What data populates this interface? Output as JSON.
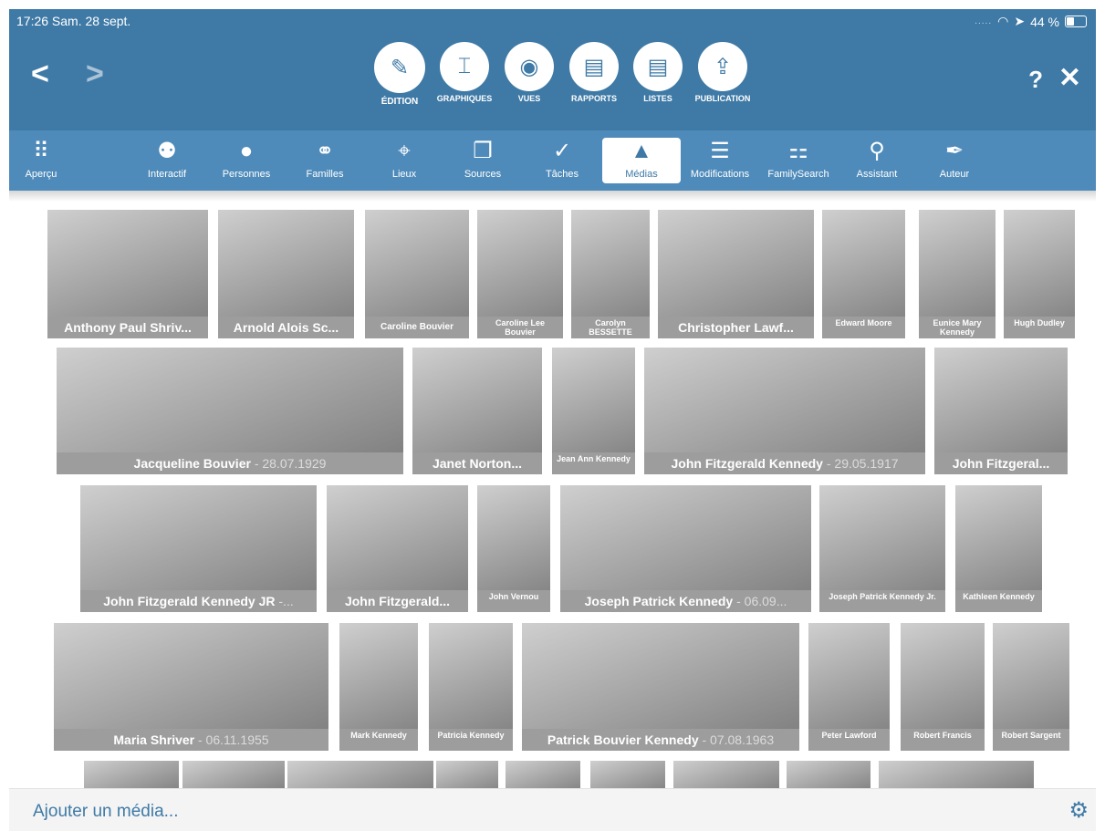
{
  "status": {
    "time": "17:26  Sam. 28 sept.",
    "signal": ".....",
    "wifi_icon": "wifi-icon",
    "location_icon": "location-icon",
    "battery": "44 %"
  },
  "toolbar": {
    "back": "<",
    "forward": ">",
    "help": "?",
    "close": "✕",
    "modes": [
      {
        "label": "ÉDITION",
        "icon": "pencil-icon",
        "glyph": "✎",
        "active": true
      },
      {
        "label": "GRAPHIQUES",
        "icon": "chart-icon",
        "glyph": "⌶"
      },
      {
        "label": "VUES",
        "icon": "eye-icon",
        "glyph": "◉"
      },
      {
        "label": "RAPPORTS",
        "icon": "report-icon",
        "glyph": "▤"
      },
      {
        "label": "LISTES",
        "icon": "list-icon",
        "glyph": "▤"
      },
      {
        "label": "PUBLICATION",
        "icon": "upload-icon",
        "glyph": "⇪"
      }
    ]
  },
  "subnav": [
    {
      "label": "Aperçu",
      "icon": "grid-icon",
      "glyph": "⠿"
    },
    {
      "label": "Interactif",
      "icon": "tree-icon",
      "glyph": "⚉"
    },
    {
      "label": "Personnes",
      "icon": "person-icon",
      "glyph": "●"
    },
    {
      "label": "Familles",
      "icon": "rings-icon",
      "glyph": "⚭"
    },
    {
      "label": "Lieux",
      "icon": "pin-icon",
      "glyph": "⌖"
    },
    {
      "label": "Sources",
      "icon": "sources-icon",
      "glyph": "❐"
    },
    {
      "label": "Tâches",
      "icon": "check-icon",
      "glyph": "✓"
    },
    {
      "label": "Médias",
      "icon": "media-icon",
      "glyph": "▲",
      "active": true
    },
    {
      "label": "Modifications",
      "icon": "changes-icon",
      "glyph": "☰"
    },
    {
      "label": "FamilySearch",
      "icon": "familysearch-icon",
      "glyph": "⚏"
    },
    {
      "label": "Assistant",
      "icon": "assistant-icon",
      "glyph": "⚲"
    },
    {
      "label": "Auteur",
      "icon": "pen-icon",
      "glyph": "✒"
    }
  ],
  "media": [
    {
      "name": "Anthony Paul Shriv...",
      "date": ""
    },
    {
      "name": "Arnold Alois Sc...",
      "date": ""
    },
    {
      "name": "Caroline Bouvier",
      "date": ""
    },
    {
      "name": "Caroline Lee Bouvier",
      "date": ""
    },
    {
      "name": "Carolyn BESSETTE",
      "date": ""
    },
    {
      "name": "Christopher Lawf...",
      "date": ""
    },
    {
      "name": "Edward Moore",
      "date": ""
    },
    {
      "name": "Eunice Mary Kennedy",
      "date": ""
    },
    {
      "name": "Hugh Dudley",
      "date": ""
    },
    {
      "name": "Jacqueline Bouvier",
      "date": " - 28.07.1929"
    },
    {
      "name": "Janet Norton...",
      "date": ""
    },
    {
      "name": "Jean Ann Kennedy",
      "date": ""
    },
    {
      "name": "John Fitzgerald Kennedy",
      "date": " - 29.05.1917"
    },
    {
      "name": "John Fitzgeral...",
      "date": ""
    },
    {
      "name": "John Fitzgerald Kennedy JR",
      "date": " -..."
    },
    {
      "name": "John Fitzgerald...",
      "date": ""
    },
    {
      "name": "John Vernou",
      "date": ""
    },
    {
      "name": "Joseph Patrick Kennedy",
      "date": " - 06.09..."
    },
    {
      "name": "Joseph Patrick Kennedy Jr.",
      "date": ""
    },
    {
      "name": "Kathleen Kennedy",
      "date": ""
    },
    {
      "name": "Maria Shriver",
      "date": " - 06.11.1955"
    },
    {
      "name": "Mark Kennedy",
      "date": ""
    },
    {
      "name": "Patricia Kennedy",
      "date": ""
    },
    {
      "name": "Patrick Bouvier Kennedy",
      "date": " - 07.08.1963"
    },
    {
      "name": "Peter Lawford",
      "date": ""
    },
    {
      "name": "Robert Francis",
      "date": ""
    },
    {
      "name": "Robert Sargent",
      "date": ""
    }
  ],
  "bottom": {
    "add_media": "Ajouter un média...",
    "settings_icon": "gear-icon"
  }
}
